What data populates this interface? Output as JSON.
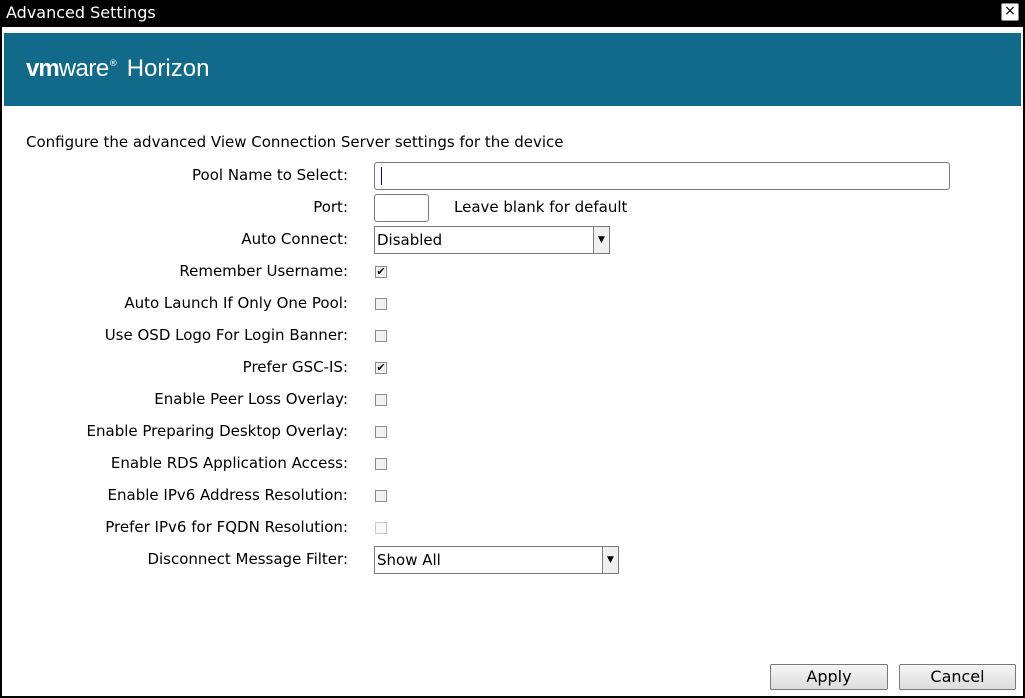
{
  "window": {
    "title": "Advanced Settings",
    "close_glyph": "×"
  },
  "brand": {
    "vm": "vm",
    "ware": "ware",
    "reg": "®",
    "product": "Horizon",
    "banner_color": "#126a8a"
  },
  "intro": "Configure the advanced View Connection Server settings for the device",
  "fields": {
    "pool_name": {
      "label": "Pool Name to Select:",
      "value": ""
    },
    "port": {
      "label": "Port:",
      "value": "",
      "hint": "Leave blank for default"
    },
    "auto_connect": {
      "label": "Auto Connect:",
      "selected": "Disabled"
    },
    "remember_username": {
      "label": "Remember Username:",
      "checked": true
    },
    "auto_launch": {
      "label": "Auto Launch If Only One Pool:",
      "checked": false
    },
    "osd_logo": {
      "label": "Use OSD Logo For Login Banner:",
      "checked": false
    },
    "prefer_gsc": {
      "label": "Prefer GSC-IS:",
      "checked": true
    },
    "peer_loss": {
      "label": "Enable Peer Loss Overlay:",
      "checked": false
    },
    "preparing_desktop": {
      "label": "Enable Preparing Desktop Overlay:",
      "checked": false
    },
    "rds_access": {
      "label": "Enable RDS Application Access:",
      "checked": false
    },
    "ipv6_resolution": {
      "label": "Enable IPv6 Address Resolution:",
      "checked": false
    },
    "ipv6_fqdn": {
      "label": "Prefer IPv6 for FQDN Resolution:",
      "checked": false,
      "disabled": true
    },
    "disconnect_filter": {
      "label": "Disconnect Message Filter:",
      "selected": "Show All"
    }
  },
  "buttons": {
    "apply": "Apply",
    "cancel": "Cancel"
  },
  "icons": {
    "check": "✔",
    "dropdown": "▼"
  }
}
